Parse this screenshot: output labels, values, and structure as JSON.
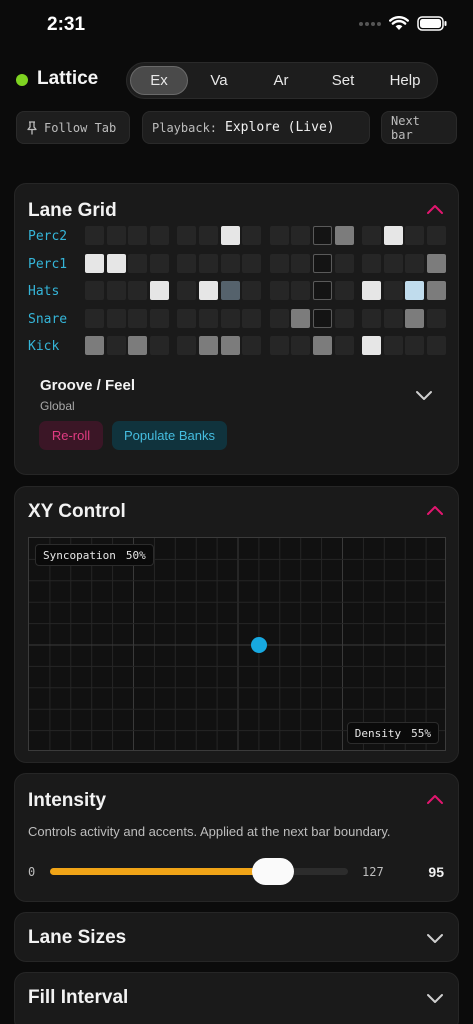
{
  "status": {
    "time": "2:31",
    "wifi_icon": "wifi-icon",
    "battery_icon": "battery-icon"
  },
  "app": {
    "name": "Lattice",
    "status_color": "#7ed321"
  },
  "tabs": [
    {
      "label": "Ex",
      "active": true
    },
    {
      "label": "Va",
      "active": false
    },
    {
      "label": "Ar",
      "active": false
    },
    {
      "label": "Set",
      "active": false
    },
    {
      "label": "Help",
      "active": false
    }
  ],
  "toolbar": {
    "follow_label": "Follow Tab",
    "follow_icon": "pin-icon",
    "playback_label": "Playback:",
    "playback_value": "Explore (Live)",
    "next_label": "Next bar"
  },
  "lane_grid": {
    "title": "Lane Grid",
    "expanded": true,
    "lanes": [
      {
        "name": "Perc2",
        "steps": [
          0,
          0,
          0,
          0,
          0,
          0,
          4,
          0,
          0,
          0,
          5,
          3,
          0,
          4,
          0,
          0
        ]
      },
      {
        "name": "Perc1",
        "steps": [
          4,
          4,
          0,
          0,
          0,
          0,
          0,
          0,
          0,
          0,
          5,
          0,
          0,
          0,
          0,
          3
        ]
      },
      {
        "name": "Hats",
        "steps": [
          0,
          0,
          0,
          4,
          0,
          4,
          6,
          0,
          0,
          0,
          5,
          0,
          4,
          0,
          7,
          3
        ]
      },
      {
        "name": "Snare",
        "steps": [
          0,
          0,
          0,
          0,
          0,
          0,
          0,
          0,
          0,
          3,
          5,
          0,
          0,
          0,
          3,
          0
        ]
      },
      {
        "name": "Kick",
        "steps": [
          3,
          0,
          3,
          0,
          0,
          3,
          3,
          0,
          0,
          0,
          3,
          0,
          4,
          0,
          0,
          0
        ]
      }
    ],
    "groove_title": "Groove / Feel",
    "groove_subtitle": "Global",
    "reroll_label": "Re-roll",
    "populate_label": "Populate Banks"
  },
  "xy_control": {
    "title": "XY Control",
    "expanded": true,
    "y_label": "Syncopation",
    "y_value_text": "50%",
    "x_label": "Density",
    "x_value_text": "55%",
    "x_value": 0.55,
    "y_value": 0.5
  },
  "intensity": {
    "title": "Intensity",
    "expanded": true,
    "description": "Controls activity and accents. Applied at the next bar boundary.",
    "min": 0,
    "max": 127,
    "value": 95,
    "min_text": "0",
    "max_text": "127",
    "value_text": "95"
  },
  "lane_sizes": {
    "title": "Lane Sizes",
    "expanded": false
  },
  "fill_interval": {
    "title": "Fill Interval",
    "expanded": false
  },
  "colors": {
    "accent_pink": "#e2166f",
    "accent_cyan": "#35b5d8",
    "slider_fill": "#f0a417",
    "xy_dot": "#17a9e1"
  }
}
